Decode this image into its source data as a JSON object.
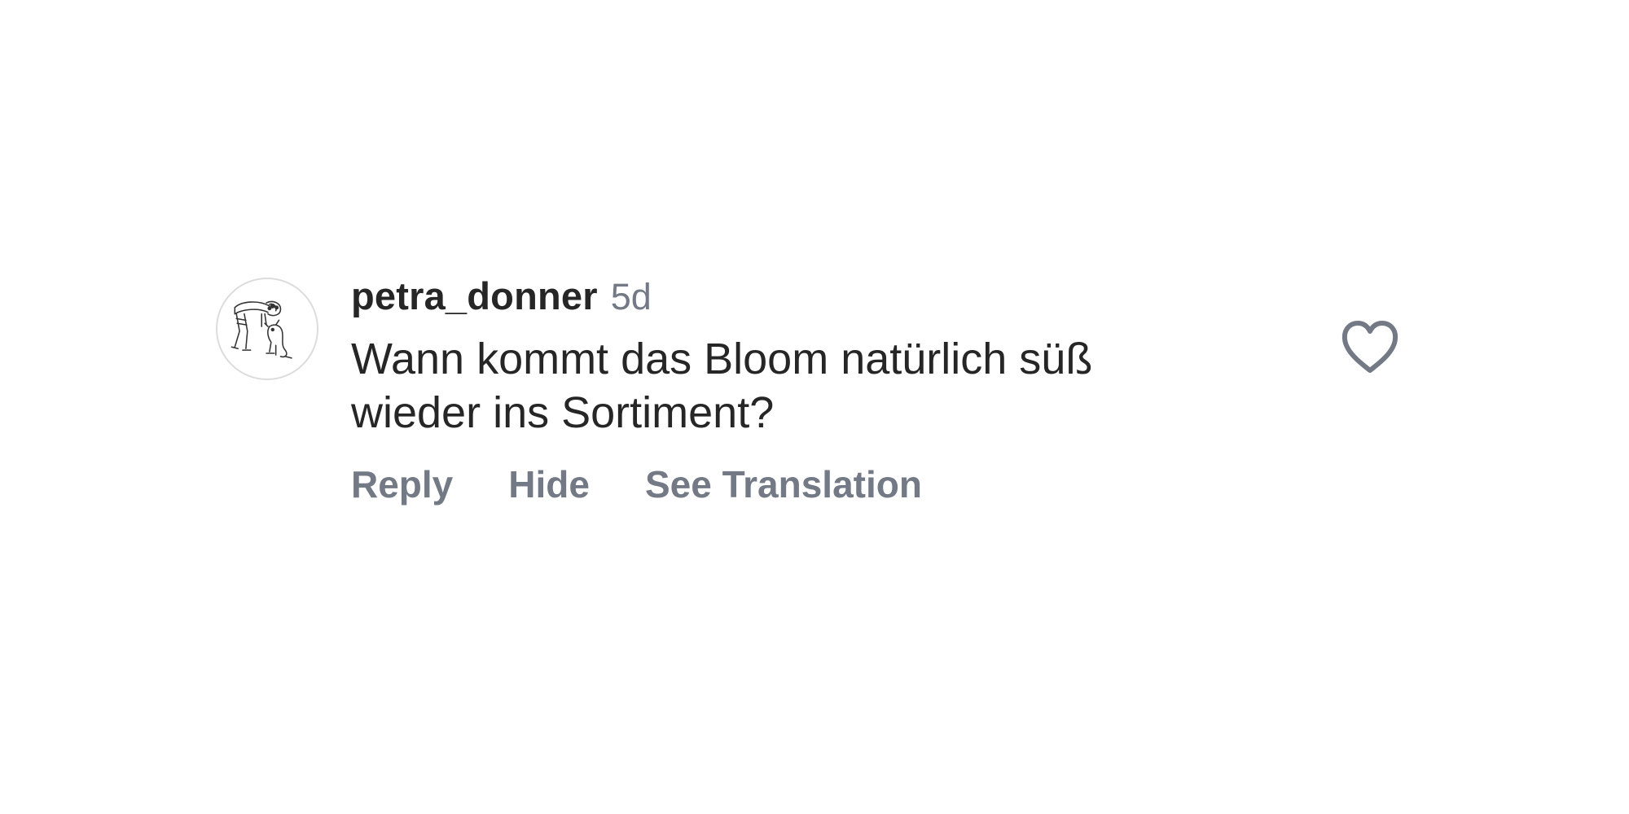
{
  "comment": {
    "avatar_icon": "user-drawing-avatar",
    "username": "petra_donner",
    "timestamp": "5d",
    "text": "Wann kommt das Bloom natürlich süß\nwieder ins Sortiment?",
    "actions": {
      "reply_label": "Reply",
      "hide_label": "Hide",
      "translate_label": "See Translation"
    },
    "like_icon": "heart-outline-icon"
  },
  "colors": {
    "primary_text": "#262626",
    "secondary_text": "#737a85",
    "background": "#ffffff"
  }
}
